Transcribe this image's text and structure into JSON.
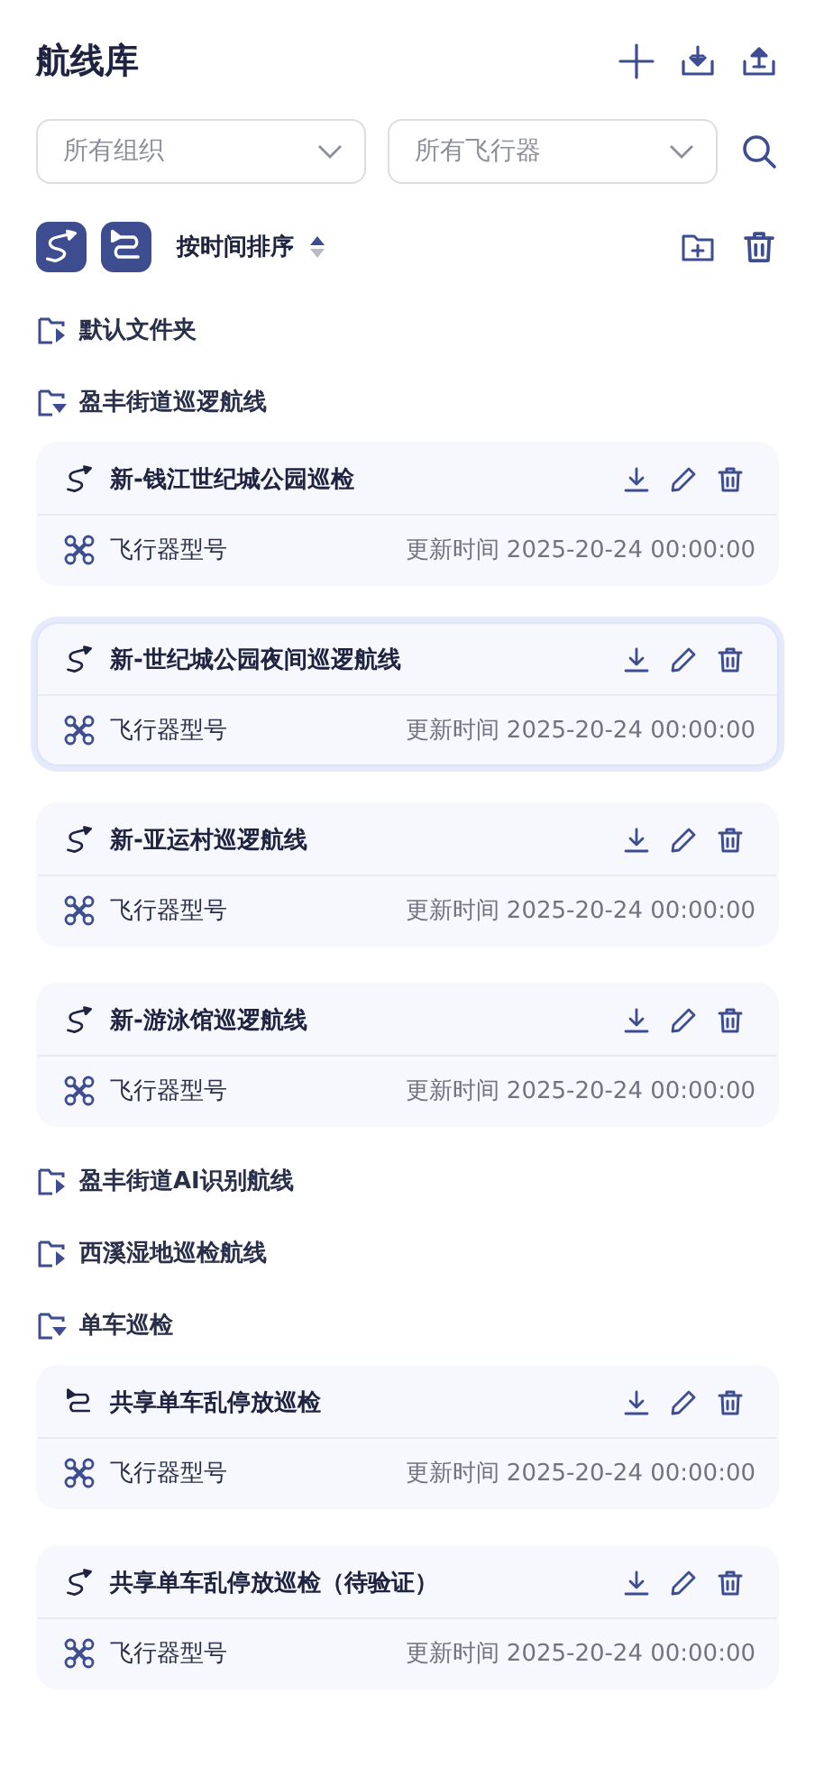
{
  "header": {
    "title": "航线库"
  },
  "filters": [
    {
      "placeholder": "所有组织"
    },
    {
      "placeholder": "所有飞行器"
    }
  ],
  "toolbar": {
    "route_types": [
      {
        "kind": "curve",
        "selected": true
      },
      {
        "kind": "zigzag",
        "selected": true
      }
    ],
    "sort_label": "按时间排序"
  },
  "folders": [
    {
      "name": "默认文件夹",
      "expanded": false
    },
    {
      "name": "盈丰街道巡逻航线",
      "expanded": true,
      "routes": [
        {
          "kind": "curve",
          "name": "新-钱江世纪城公园巡检",
          "aircraft": "飞行器型号",
          "updated": "更新时间 2025-20-24 00:00:00",
          "selected": false
        },
        {
          "kind": "curve",
          "name": "新-世纪城公园夜间巡逻航线",
          "aircraft": "飞行器型号",
          "updated": "更新时间 2025-20-24 00:00:00",
          "selected": true
        },
        {
          "kind": "curve",
          "name": "新-亚运村巡逻航线",
          "aircraft": "飞行器型号",
          "updated": "更新时间 2025-20-24 00:00:00",
          "selected": false
        },
        {
          "kind": "curve",
          "name": "新-游泳馆巡逻航线",
          "aircraft": "飞行器型号",
          "updated": "更新时间 2025-20-24 00:00:00",
          "selected": false
        }
      ]
    },
    {
      "name": "盈丰街道AI识别航线",
      "expanded": false
    },
    {
      "name": "西溪湿地巡检航线",
      "expanded": false
    },
    {
      "name": "单车巡检",
      "expanded": true,
      "routes": [
        {
          "kind": "zigzag",
          "name": "共享单车乱停放巡检",
          "aircraft": "飞行器型号",
          "updated": "更新时间 2025-20-24 00:00:00",
          "selected": false
        },
        {
          "kind": "curve",
          "name": "共享单车乱停放巡检（待验证）",
          "aircraft": "飞行器型号",
          "updated": "更新时间 2025-20-24 00:00:00",
          "selected": false
        }
      ]
    }
  ]
}
